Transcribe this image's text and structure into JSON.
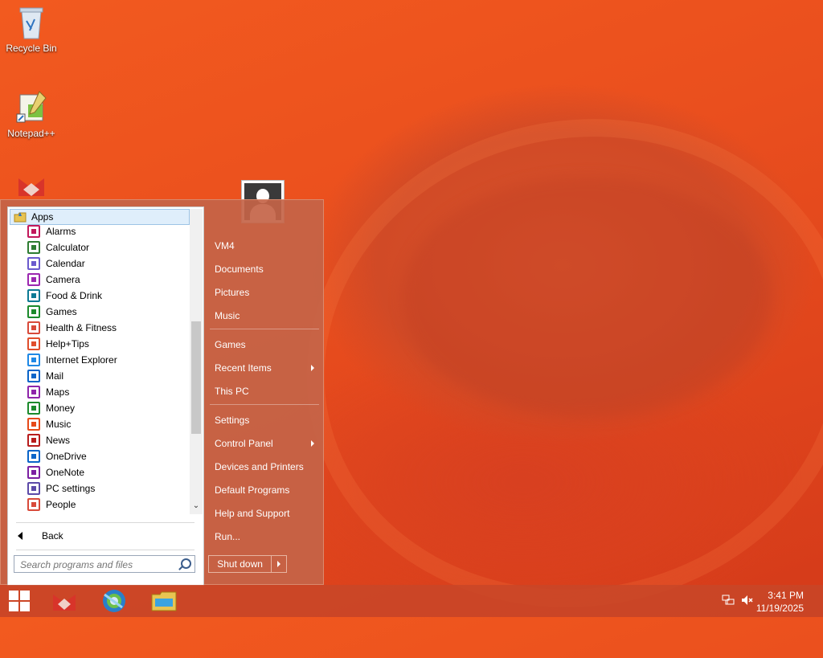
{
  "desktop": {
    "icons": [
      {
        "label": "Recycle Bin",
        "icon": "recycle-bin-icon"
      },
      {
        "label": "Notepad++",
        "icon": "notepad-plus-plus-icon"
      },
      {
        "label": "",
        "icon": "app-shortcut-icon"
      }
    ]
  },
  "start_menu": {
    "apps_header": "Apps",
    "apps": [
      {
        "label": "Alarms",
        "icon": "alarm-clock-icon",
        "color": "#c2185b"
      },
      {
        "label": "Calculator",
        "icon": "calculator-icon",
        "color": "#2e7d32"
      },
      {
        "label": "Calendar",
        "icon": "calendar-icon",
        "color": "#6a5acd"
      },
      {
        "label": "Camera",
        "icon": "camera-icon",
        "color": "#9c27b0"
      },
      {
        "label": "Food & Drink",
        "icon": "food-drink-icon",
        "color": "#0d7a94"
      },
      {
        "label": "Games",
        "icon": "games-icon",
        "color": "#1b8a2b"
      },
      {
        "label": "Health & Fitness",
        "icon": "health-fitness-icon",
        "color": "#d84a3a"
      },
      {
        "label": "Help+Tips",
        "icon": "help-tips-icon",
        "color": "#e04e2c"
      },
      {
        "label": "Internet Explorer",
        "icon": "internet-explorer-icon",
        "color": "#1e88e5"
      },
      {
        "label": "Mail",
        "icon": "mail-icon",
        "color": "#0a64c8"
      },
      {
        "label": "Maps",
        "icon": "maps-icon",
        "color": "#8e24aa"
      },
      {
        "label": "Money",
        "icon": "money-icon",
        "color": "#1b8a2b"
      },
      {
        "label": "Music",
        "icon": "music-icon",
        "color": "#e64a19"
      },
      {
        "label": "News",
        "icon": "news-icon",
        "color": "#b71c1c"
      },
      {
        "label": "OneDrive",
        "icon": "onedrive-icon",
        "color": "#0a64c8"
      },
      {
        "label": "OneNote",
        "icon": "onenote-icon",
        "color": "#7b1fa2"
      },
      {
        "label": "PC settings",
        "icon": "pc-settings-icon",
        "color": "#5c4aa8"
      },
      {
        "label": "People",
        "icon": "people-icon",
        "color": "#d84a3a"
      }
    ],
    "back_label": "Back",
    "search_placeholder": "Search programs and files",
    "right_items": [
      {
        "label": "VM4",
        "has_submenu": false
      },
      {
        "label": "Documents",
        "has_submenu": false
      },
      {
        "label": "Pictures",
        "has_submenu": false
      },
      {
        "label": "Music",
        "has_submenu": false
      },
      {
        "label": "Games",
        "has_submenu": false
      },
      {
        "label": "Recent Items",
        "has_submenu": true
      },
      {
        "label": "This PC",
        "has_submenu": false
      },
      {
        "label": "Settings",
        "has_submenu": false
      },
      {
        "label": "Control Panel",
        "has_submenu": true
      },
      {
        "label": "Devices and Printers",
        "has_submenu": false
      },
      {
        "label": "Default Programs",
        "has_submenu": false
      },
      {
        "label": "Help and Support",
        "has_submenu": false
      },
      {
        "label": "Run...",
        "has_submenu": false
      }
    ],
    "shutdown_label": "Shut down"
  },
  "taskbar": {
    "pinned": [
      {
        "icon": "windows-start-icon"
      },
      {
        "icon": "app-shortcut-icon"
      },
      {
        "icon": "browser-icon"
      },
      {
        "icon": "file-explorer-icon"
      }
    ],
    "tray": [
      {
        "icon": "network-icon"
      },
      {
        "icon": "volume-muted-icon"
      }
    ],
    "time": "3:41 PM",
    "date": "11/19/2025"
  },
  "colors": {
    "accent": "#c46448",
    "taskbar": "#c84628",
    "desktop": "#ea4f1e"
  }
}
